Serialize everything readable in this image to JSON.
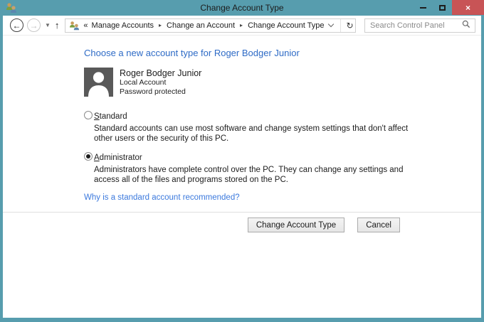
{
  "window": {
    "title": "Change Account Type"
  },
  "titlebar_controls": {
    "close_glyph": "×"
  },
  "navbar": {
    "breadcrumb": {
      "prefix": "«",
      "separator": "▸",
      "items": [
        "Manage Accounts",
        "Change an Account",
        "Change Account Type"
      ]
    },
    "refresh_glyph": "↻",
    "search": {
      "placeholder": "Search Control Panel"
    }
  },
  "main": {
    "heading": "Choose a new account type for Roger Bodger Junior",
    "user": {
      "name": "Roger Bodger Junior",
      "account_type": "Local Account",
      "protection": "Password protected"
    },
    "options": [
      {
        "access_key": "S",
        "label_rest": "tandard",
        "selected": false,
        "description": "Standard accounts can use most software and change system settings that don't affect other users or the security of this PC."
      },
      {
        "access_key": "A",
        "label_rest": "dministrator",
        "selected": true,
        "description": "Administrators have complete control over the PC. They can change any settings and access all of the files and programs stored on the PC."
      }
    ],
    "link": "Why is a standard account recommended?",
    "buttons": {
      "primary": "Change Account Type",
      "cancel": "Cancel"
    }
  },
  "colors": {
    "titlebar": "#579DAE",
    "close_button": "#C85456",
    "heading": "#2E6BC6",
    "link": "#3B79DD"
  }
}
